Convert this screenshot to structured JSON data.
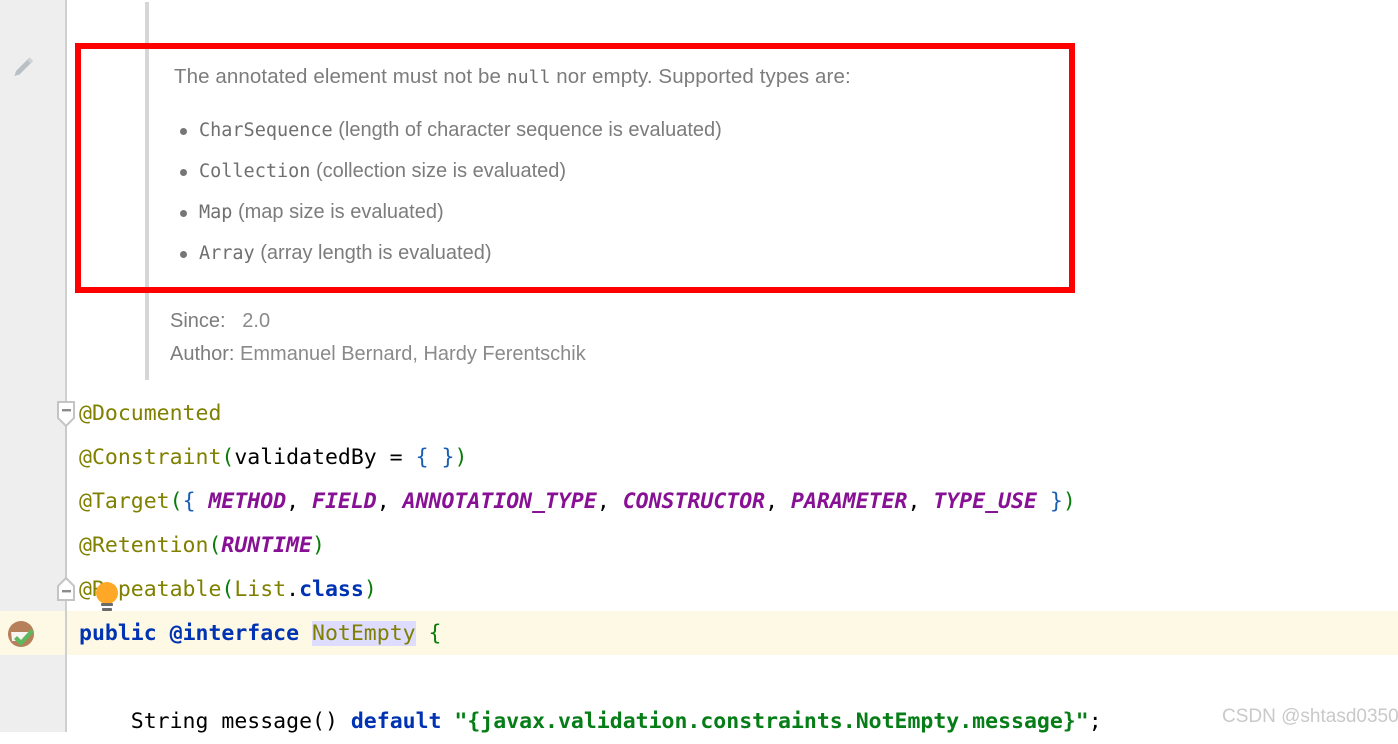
{
  "doc": {
    "lead_before": "The annotated element must not be ",
    "lead_code": "null",
    "lead_after": " nor empty. Supported types are:",
    "items": [
      {
        "code": "CharSequence",
        "text": " (length of character sequence is evaluated)"
      },
      {
        "code": "Collection",
        "text": " (collection size is evaluated)"
      },
      {
        "code": "Map",
        "text": " (map size is evaluated)"
      },
      {
        "code": "Array",
        "text": " (array length is evaluated)"
      }
    ],
    "meta": [
      {
        "key": "Since:",
        "value": "2.0"
      },
      {
        "key": "Author:",
        "value": "Emmanuel Bernard, Hardy Ferentschik"
      }
    ]
  },
  "code": {
    "line1": {
      "annotation": "@Documented"
    },
    "line2": {
      "annotation": "@Constraint",
      "open_paren": "(",
      "param": "validatedBy",
      "eq": " = ",
      "brace_open": "{",
      "brace_space": " ",
      "brace_close": "}",
      "close_paren": ")"
    },
    "line3": {
      "annotation": "@Target",
      "open_paren": "(",
      "brace_open": "{",
      "space": " ",
      "constants": [
        "METHOD",
        "FIELD",
        "ANNOTATION_TYPE",
        "CONSTRUCTOR",
        "PARAMETER",
        "TYPE_USE"
      ],
      "separator": ", ",
      "brace_close": " }",
      "close_paren": ")"
    },
    "line4": {
      "annotation": "@Retention",
      "open_paren": "(",
      "constant": "RUNTIME",
      "close_paren": ")"
    },
    "line5": {
      "annotation": "@Repeatable",
      "open_paren": "(",
      "type": "List",
      "dot": ".",
      "keyword": "class",
      "close_paren": ")"
    },
    "line6": {
      "kw_public": "public",
      "space1": " ",
      "kw_interface": "@interface",
      "space2": " ",
      "type_name": "NotEmpty",
      "space3": " ",
      "brace": "{"
    },
    "line7": {
      "indent": "    ",
      "type": "String",
      "space1": " ",
      "method": "message()",
      "space2": " ",
      "kw_default": "default",
      "space3": " ",
      "string": "\"{javax.validation.constraints.NotEmpty.message}\"",
      "semicolon": ";"
    }
  },
  "gutter": {
    "edit_icon": "pencil-icon",
    "inspection_icon": "inspection-check-icon",
    "bulb_icon": "intention-bulb-icon",
    "fold_expanded": "fold-collapse-icon",
    "fold_end": "fold-end-icon"
  },
  "watermark": {
    "text": "CSDN @shtasd0350"
  },
  "colors": {
    "annotation": "#808000",
    "constant": "#871094",
    "keyword": "#0033b3",
    "string": "#067d17",
    "paren_green": "#0a7c0a",
    "brace_blue": "#1a5fb4",
    "highlight_line": "#fdf9e4",
    "name_highlight": "#dedcff",
    "red_box": "#fe0000",
    "teal_mark": "#9ad9c3"
  }
}
